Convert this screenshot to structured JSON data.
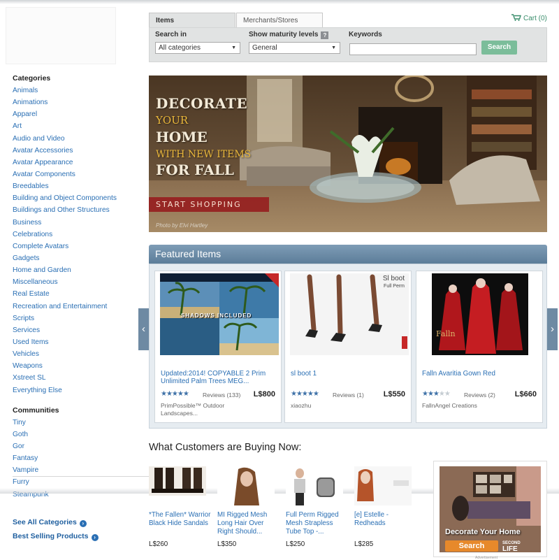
{
  "search": {
    "tabs": [
      "Items",
      "Merchants/Stores"
    ],
    "cart": "Cart (0)",
    "search_in_label": "Search in",
    "search_in_value": "All categories",
    "maturity_label": "Show maturity levels",
    "maturity_help": "?",
    "maturity_value": "General",
    "keywords_label": "Keywords",
    "keywords_value": "",
    "search_button": "Search"
  },
  "sidebar": {
    "categories_heading": "Categories",
    "categories": [
      "Animals",
      "Animations",
      "Apparel",
      "Art",
      "Audio and Video",
      "Avatar Accessories",
      "Avatar Appearance",
      "Avatar Components",
      "Breedables",
      "Building and Object Components",
      "Buildings and Other Structures",
      "Business",
      "Celebrations",
      "Complete Avatars",
      "Gadgets",
      "Home and Garden",
      "Miscellaneous",
      "Real Estate",
      "Recreation and Entertainment",
      "Scripts",
      "Services",
      "Used Items",
      "Vehicles",
      "Weapons",
      "Xstreet SL",
      "Everything Else"
    ],
    "communities_heading": "Communities",
    "communities": [
      "Tiny",
      "Goth",
      "Gor",
      "Fantasy",
      "Vampire",
      "Furry",
      "Steampunk"
    ],
    "see_all": "See All Categories",
    "best_selling": "Best Selling Products"
  },
  "banner": {
    "line1": "DECORATE",
    "line2": "YOUR",
    "line3": "HOME",
    "line4": "WITH NEW ITEMS",
    "line5": "FOR FALL",
    "cta": "START SHOPPING",
    "credit": "Photo by Elvi Hartley"
  },
  "featured": {
    "heading": "Featured Items",
    "prev": "‹",
    "next": "›",
    "items": [
      {
        "title": "Updated:2014! COPYABLE 2 Prim Unlimited Palm Trees MEG...",
        "rating": 5,
        "reviews": "Reviews (133)",
        "price": "L$800",
        "seller": "PrimPossible™ Outdoor Landscapes...",
        "img_text1": "Shadows Included"
      },
      {
        "title": "sl boot 1",
        "rating": 5,
        "reviews": "Reviews (1)",
        "price": "L$550",
        "seller": "xiaozhu",
        "img_text1": "Sl boot",
        "img_text2": "Full Perm"
      },
      {
        "title": "Falln Avaritia Gown Red",
        "rating": 3,
        "reviews": "Reviews (2)",
        "price": "L$660",
        "seller": "FallnAngel Creations",
        "img_text1": "Falln"
      }
    ]
  },
  "customers": {
    "heading": "What Customers are Buying Now:",
    "items": [
      {
        "title": "*The Fallen* Warrior Black Hide Sandals",
        "price": "L$260"
      },
      {
        "title": "MI Rigged Mesh Long Hair Over Right Should...",
        "price": "L$350"
      },
      {
        "title": "Full Perm Rigged Mesh Strapless Tube Top -...",
        "price": "L$250"
      },
      {
        "title": "[e] Estelle - Redheads",
        "price": "L$285"
      }
    ]
  },
  "ad": {
    "caption": "Decorate Your Home",
    "button": "Search",
    "brand": "LIFE",
    "brand_small": "SECOND",
    "label": "Advertisement"
  },
  "colors": {
    "link": "#2a6fb4",
    "search_button": "#7bbd9a",
    "featured_header": "#6e8aa3",
    "star": "#3f72a8",
    "cta": "#962020"
  }
}
